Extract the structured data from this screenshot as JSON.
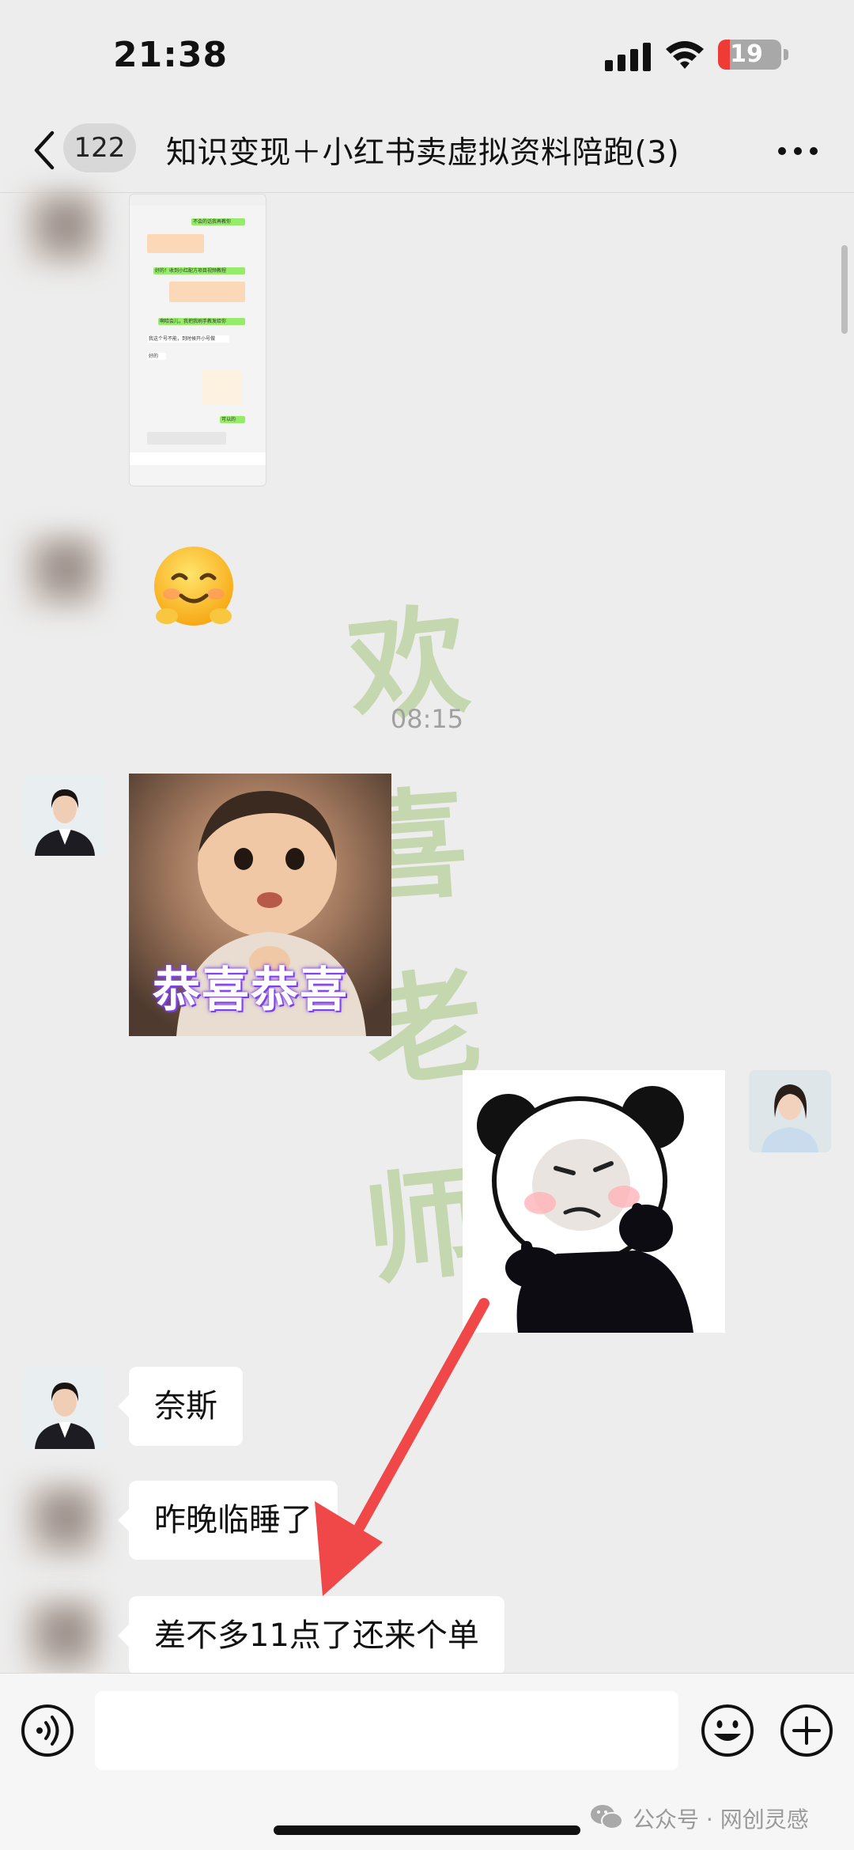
{
  "status_bar": {
    "time": "21:38",
    "battery": "19",
    "battery_level": 0.19
  },
  "nav": {
    "unread_count": "122",
    "title": "知识变现＋小红书卖虚拟资料陪跑(3)"
  },
  "screenshot_preview": {
    "lines": [
      "不会的话我再教你",
      "好的！收到小红配方项目视频教程",
      "啊哈会儿，我把我刷手教发给你",
      "我这个号不能，到时候开小号做",
      "好的",
      "可以的"
    ]
  },
  "chat": {
    "timestamp": "08:15",
    "sticker_caption": "恭喜恭喜",
    "messages": [
      {
        "text": "奈斯"
      },
      {
        "text": "昨晚临睡了"
      },
      {
        "text": "差不多11点了还来个单"
      }
    ]
  },
  "watermark": {
    "chars": [
      "欢",
      "喜",
      "老",
      "师"
    ]
  },
  "footer": {
    "account_label": "公众号 · 网创灵感"
  },
  "colors": {
    "background": "#ededed",
    "bubble": "#ffffff",
    "arrow": "#f04848",
    "watermark": "#a3c47c"
  },
  "icons": [
    "back-icon",
    "more-icon",
    "voice-icon",
    "emoji-icon",
    "plus-icon",
    "wifi-icon",
    "signal-icon",
    "wechat-icon"
  ]
}
